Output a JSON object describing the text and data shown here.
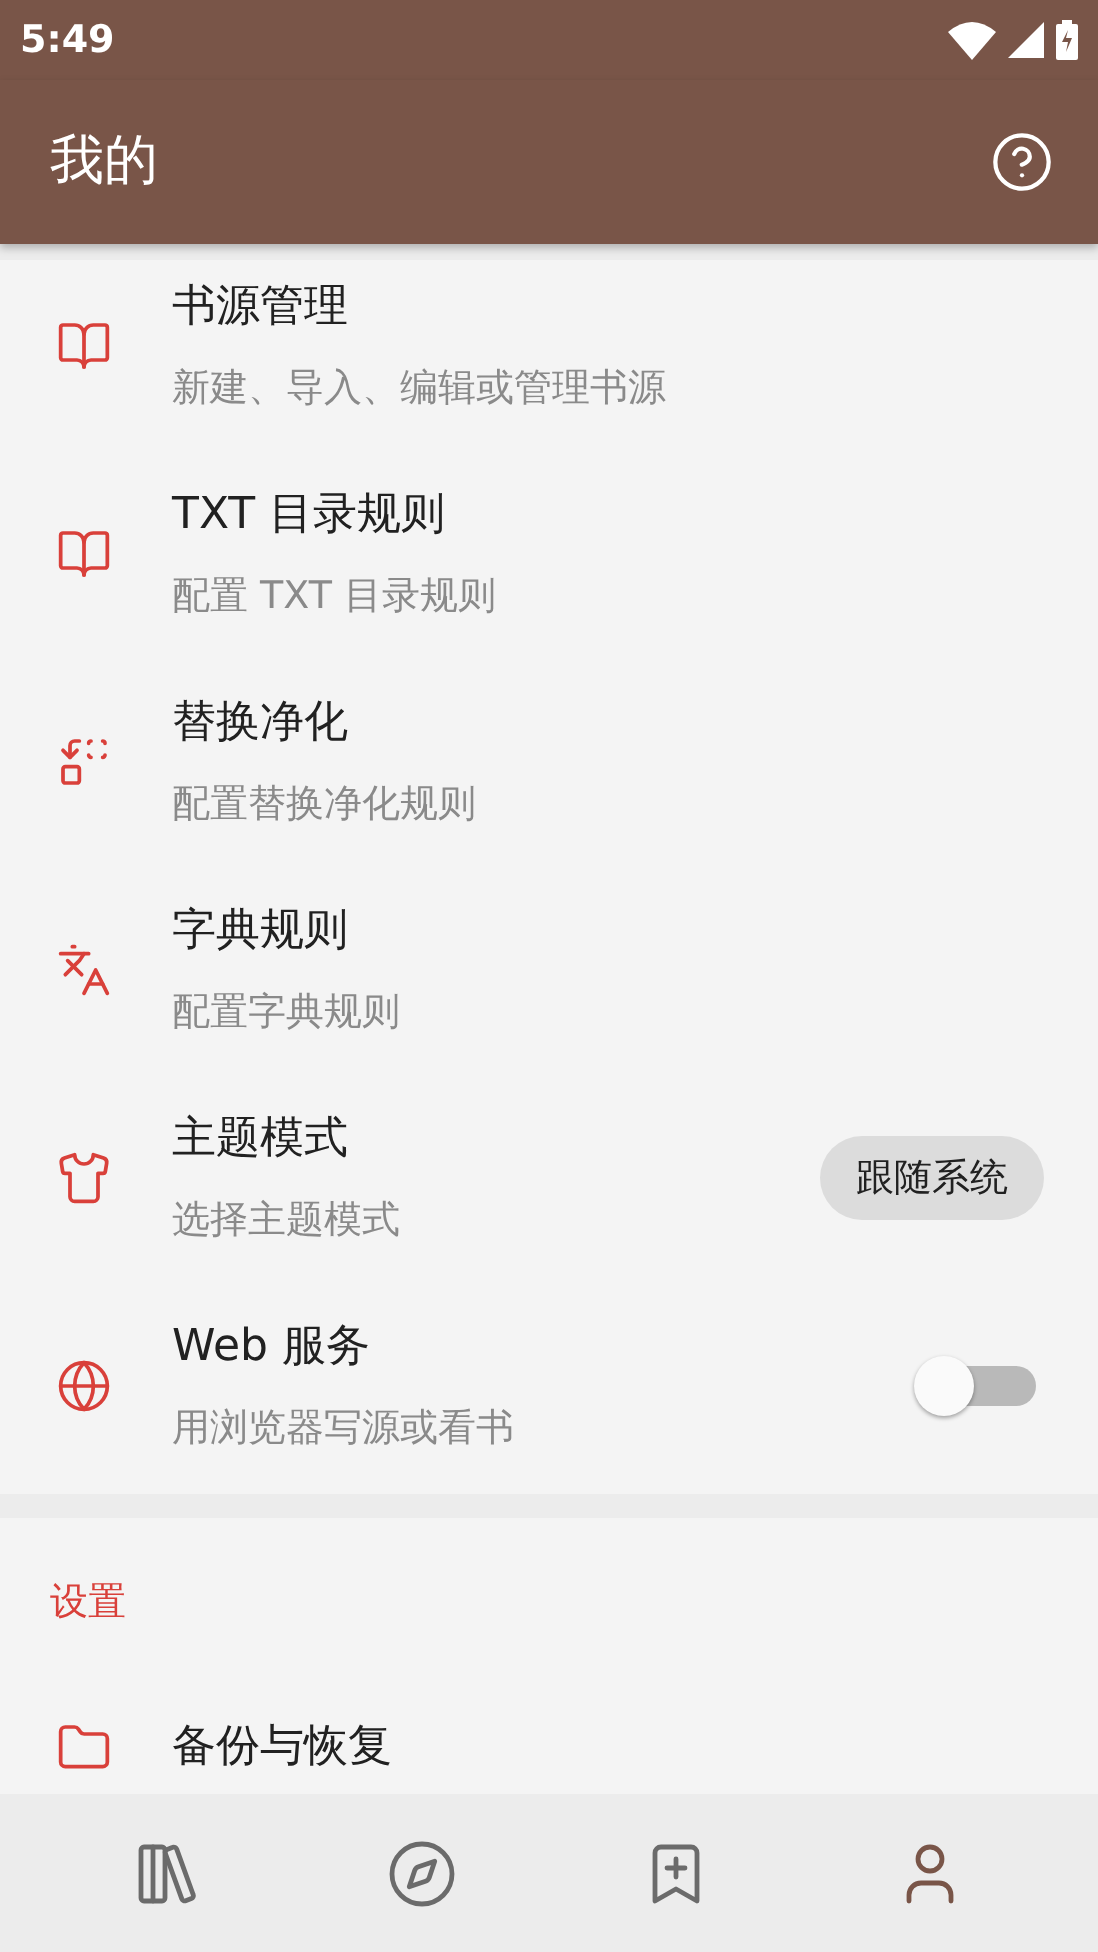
{
  "status_bar": {
    "time": "5:49"
  },
  "app_bar": {
    "title": "我的"
  },
  "items": [
    {
      "kind": "plain",
      "title": "书源管理",
      "subtitle": "新建、导入、编辑或管理书源"
    },
    {
      "kind": "plain",
      "title": "TXT 目录规则",
      "subtitle": "配置 TXT 目录规则"
    },
    {
      "kind": "plain",
      "title": "替换净化",
      "subtitle": "配置替换净化规则"
    },
    {
      "kind": "plain",
      "title": "字典规则",
      "subtitle": "配置字典规则"
    },
    {
      "kind": "chip",
      "title": "主题模式",
      "subtitle": "选择主题模式",
      "value": "跟随系统"
    },
    {
      "kind": "switch",
      "title": "Web 服务",
      "subtitle": "用浏览器写源或看书",
      "on": false
    }
  ],
  "settings": {
    "header": "设置",
    "items": [
      {
        "title": "备份与恢复"
      }
    ]
  },
  "bottom_nav": [
    {
      "selected": false
    },
    {
      "selected": false
    },
    {
      "selected": false
    },
    {
      "selected": true
    }
  ]
}
